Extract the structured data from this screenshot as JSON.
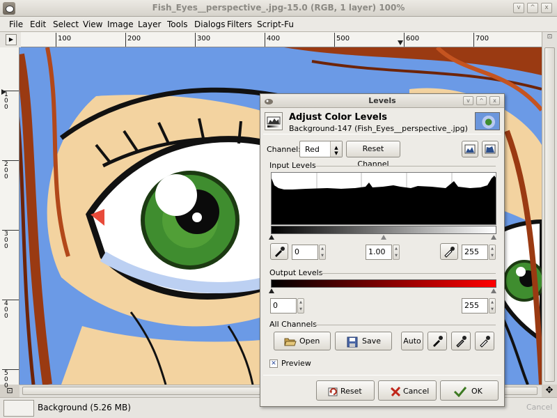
{
  "window": {
    "title": "Fish_Eyes__perspective_.jpg-15.0 (RGB, 1 layer) 100%",
    "controls": [
      "v",
      "^",
      "x"
    ]
  },
  "menubar": {
    "items": [
      "File",
      "Edit",
      "Select",
      "View",
      "Image",
      "Layer",
      "Tools",
      "Dialogs",
      "Filters",
      "Script-Fu"
    ]
  },
  "ruler": {
    "h_labels": [
      "100",
      "200",
      "300",
      "400",
      "500",
      "600",
      "700"
    ],
    "v_labels": [
      "100",
      "200",
      "300",
      "400",
      "500"
    ]
  },
  "status": {
    "layer_info": "Background (5.26 MB)",
    "cancel_label": "Cancel"
  },
  "levels": {
    "title": "Levels",
    "header_title": "Adjust Color Levels",
    "header_subtitle": "Background-147 (Fish_Eyes__perspective_.jpg)",
    "channel_label": "Channel:",
    "channel_value": "Red",
    "reset_channel": "Reset Channel",
    "input_levels_label": "Input Levels",
    "input_low": "0",
    "input_gamma": "1.00",
    "input_high": "255",
    "output_levels_label": "Output Levels",
    "output_low": "0",
    "output_high": "255",
    "all_channels_label": "All Channels",
    "open_label": "Open",
    "save_label": "Save",
    "auto_label": "Auto",
    "preview_label": "Preview",
    "preview_checked": true,
    "reset_label": "Reset",
    "cancel_label": "Cancel",
    "ok_label": "OK"
  },
  "colors": {
    "sky": "#6b9ae6",
    "skin": "#f3d3a0",
    "hair": "#9a3a12",
    "iris": "#3f8d2f",
    "output_gradient_end": "#ff0000"
  }
}
